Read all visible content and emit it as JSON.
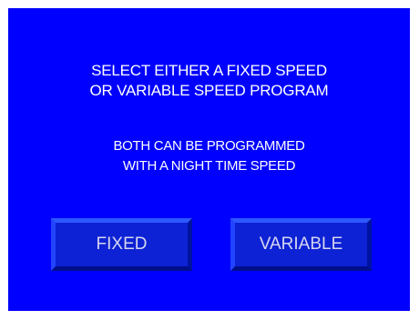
{
  "colors": {
    "background": "#0000fe",
    "text": "#ffffff",
    "button_face": "#0d22d4",
    "button_text": "#d6d6f0"
  },
  "headline": {
    "line1": "SELECT EITHER A FIXED SPEED",
    "line2": "OR VARIABLE SPEED PROGRAM"
  },
  "subline": {
    "line1": "BOTH CAN BE PROGRAMMED",
    "line2": "WITH A NIGHT TIME SPEED"
  },
  "buttons": {
    "fixed_label": "FIXED",
    "variable_label": "VARIABLE"
  }
}
